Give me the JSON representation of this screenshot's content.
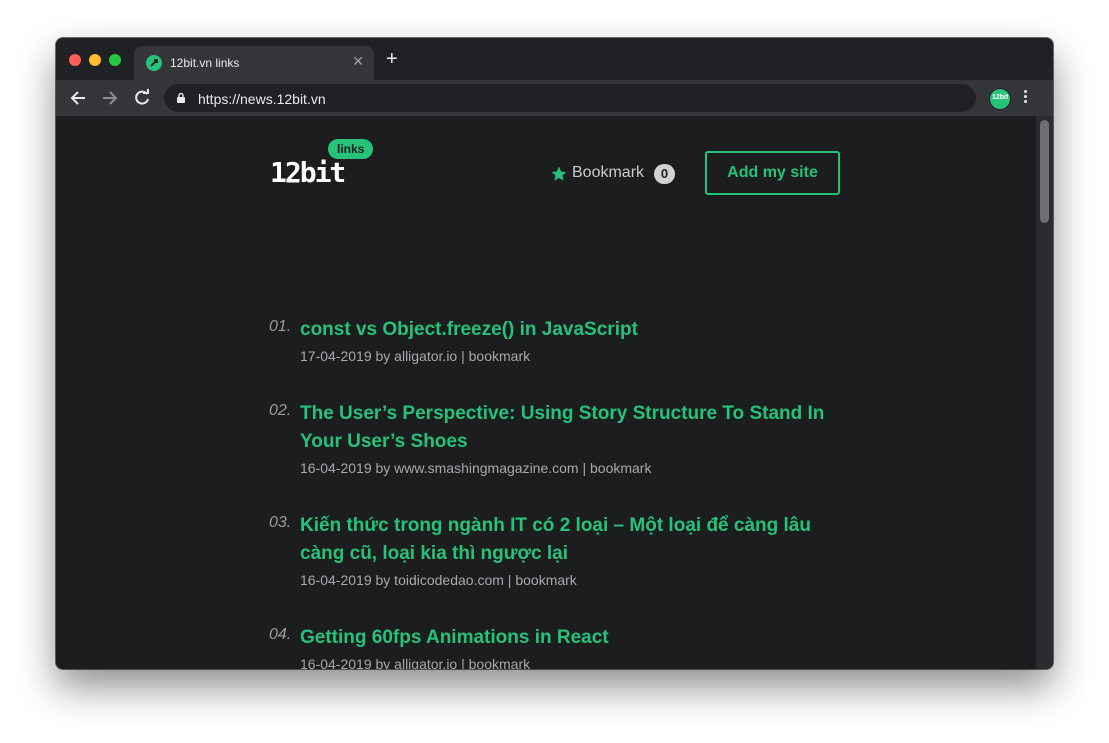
{
  "browser": {
    "tab_title": "12bit.vn links",
    "url": "https://news.12bit.vn",
    "profile_label": "12bit"
  },
  "site": {
    "logo_text": "12bit",
    "logo_badge": "links",
    "bookmark_label": "Bookmark",
    "bookmark_count": "0",
    "add_site_label": "Add my site",
    "accent_color": "#27c27a"
  },
  "items": [
    {
      "num": "01.",
      "title": "const vs Object.freeze() in JavaScript",
      "meta": "17-04-2019 by alligator.io | bookmark"
    },
    {
      "num": "02.",
      "title": "The User’s Perspective: Using Story Structure To Stand In Your User’s Shoes",
      "meta": "16-04-2019 by www.smashingmagazine.com | bookmark"
    },
    {
      "num": "03.",
      "title": "Kiến thức trong ngành IT có 2 loại – Một loại để càng lâu càng cũ, loại kia thì ngược lại",
      "meta": "16-04-2019 by toidicodedao.com | bookmark"
    },
    {
      "num": "04.",
      "title": "Getting 60fps Animations in React",
      "meta": "16-04-2019 by alligator.io | bookmark"
    }
  ]
}
